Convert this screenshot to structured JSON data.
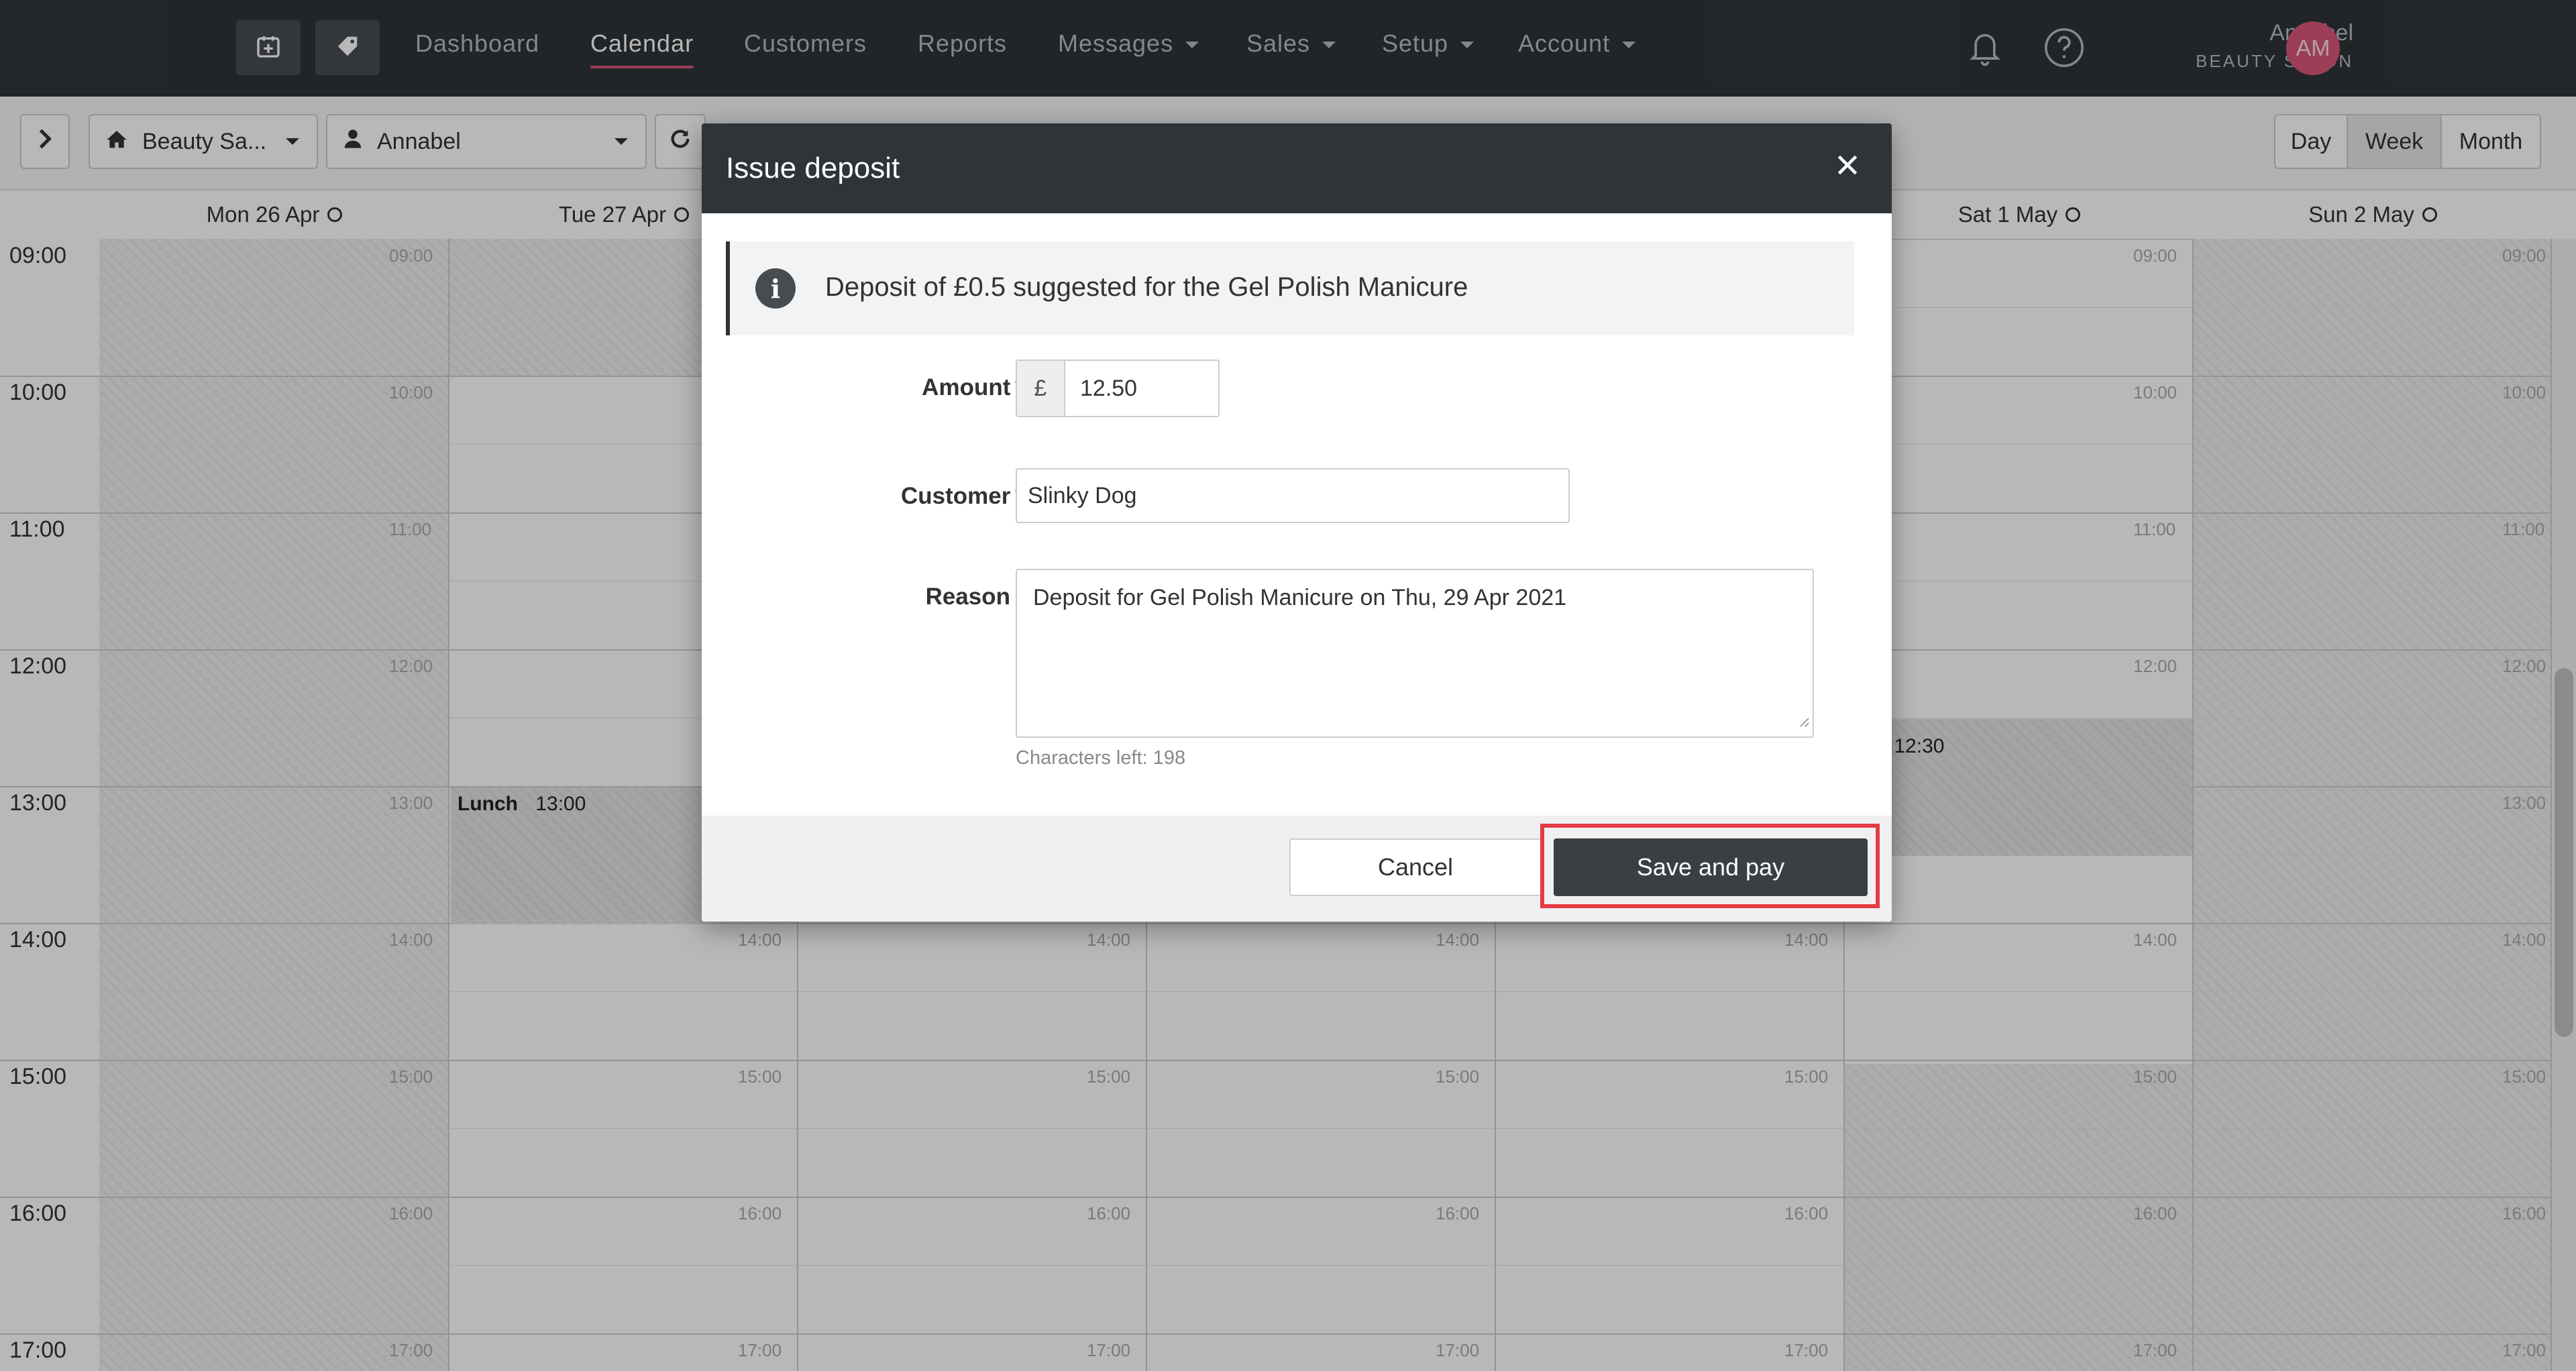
{
  "nav": {
    "links": [
      "Dashboard",
      "Calendar",
      "Customers",
      "Reports",
      "Messages",
      "Sales",
      "Setup",
      "Account"
    ],
    "user_name": "Annabel",
    "user_business": "BEAUTY SALON",
    "avatar_initials": "AM"
  },
  "toolbar": {
    "location": "Beauty Sa...",
    "staff": "Annabel",
    "views": [
      "Day",
      "Week",
      "Month"
    ],
    "active_view": "Week"
  },
  "calendar": {
    "days": [
      "Mon 26 Apr",
      "Tue 27 Apr",
      "",
      "",
      "",
      "Sat 1 May",
      "Sun 2 May"
    ],
    "hours": [
      "09:00",
      "10:00",
      "11:00",
      "12:00",
      "13:00",
      "14:00",
      "15:00",
      "16:00",
      "17:00"
    ],
    "lunch_tue": {
      "label": "Lunch",
      "time": "13:00"
    },
    "lunch_sat": {
      "label": "ch",
      "time": "12:30"
    }
  },
  "modal": {
    "title": "Issue deposit",
    "info": "Deposit of £0.5 suggested for the Gel Polish Manicure",
    "amount_label": "Amount",
    "currency": "£",
    "amount_value": "12.50",
    "customer_label": "Customer",
    "customer_value": "Slinky Dog",
    "reason_label": "Reason",
    "reason_value": "Deposit for Gel Polish Manicure  on Thu, 29 Apr 2021",
    "chars_left": "Characters left: 198",
    "cancel_label": "Cancel",
    "save_label": "Save and pay"
  },
  "colors": {
    "accent": "#d9577a",
    "dark": "#2f3438",
    "highlight": "#e23c44"
  }
}
